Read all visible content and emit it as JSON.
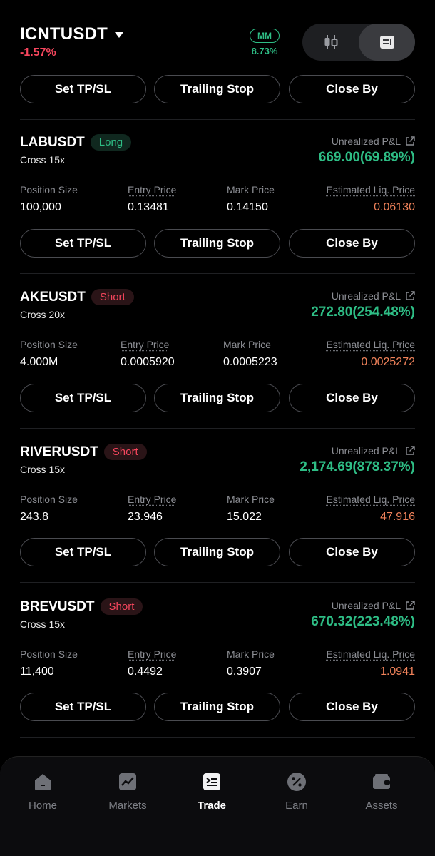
{
  "header": {
    "symbol": "ICNTUSDT",
    "change": "-1.57%",
    "mm_label": "MM",
    "mm_value": "8.73%"
  },
  "actions": {
    "set_tpsl": "Set TP/SL",
    "trailing_stop": "Trailing Stop",
    "close_by": "Close By"
  },
  "labels": {
    "unrealized_pnl": "Unrealized P&L",
    "position_size": "Position Size",
    "entry_price": "Entry Price",
    "mark_price": "Mark Price",
    "est_liq_price": "Estimated Liq. Price"
  },
  "positions": [
    {
      "pair": "LABUSDT",
      "side": "Long",
      "leverage": "Cross 15x",
      "pnl": "669.00(69.89%)",
      "size": "100,000",
      "entry": "0.13481",
      "mark": "0.14150",
      "liq": "0.06130"
    },
    {
      "pair": "AKEUSDT",
      "side": "Short",
      "leverage": "Cross 20x",
      "pnl": "272.80(254.48%)",
      "size": "4.000M",
      "entry": "0.0005920",
      "mark": "0.0005223",
      "liq": "0.0025272"
    },
    {
      "pair": "RIVERUSDT",
      "side": "Short",
      "leverage": "Cross 15x",
      "pnl": "2,174.69(878.37%)",
      "size": "243.8",
      "entry": "23.946",
      "mark": "15.022",
      "liq": "47.916"
    },
    {
      "pair": "BREVUSDT",
      "side": "Short",
      "leverage": "Cross 15x",
      "pnl": "670.32(223.48%)",
      "size": "11,400",
      "entry": "0.4492",
      "mark": "0.3907",
      "liq": "1.0941"
    }
  ],
  "nav": [
    {
      "label": "Home",
      "icon": "home-icon"
    },
    {
      "label": "Markets",
      "icon": "markets-icon"
    },
    {
      "label": "Trade",
      "icon": "trade-icon"
    },
    {
      "label": "Earn",
      "icon": "earn-icon"
    },
    {
      "label": "Assets",
      "icon": "wallet-icon"
    }
  ],
  "colors": {
    "positive": "#2ebd85",
    "negative": "#f6465d",
    "liq": "#f0825a"
  }
}
